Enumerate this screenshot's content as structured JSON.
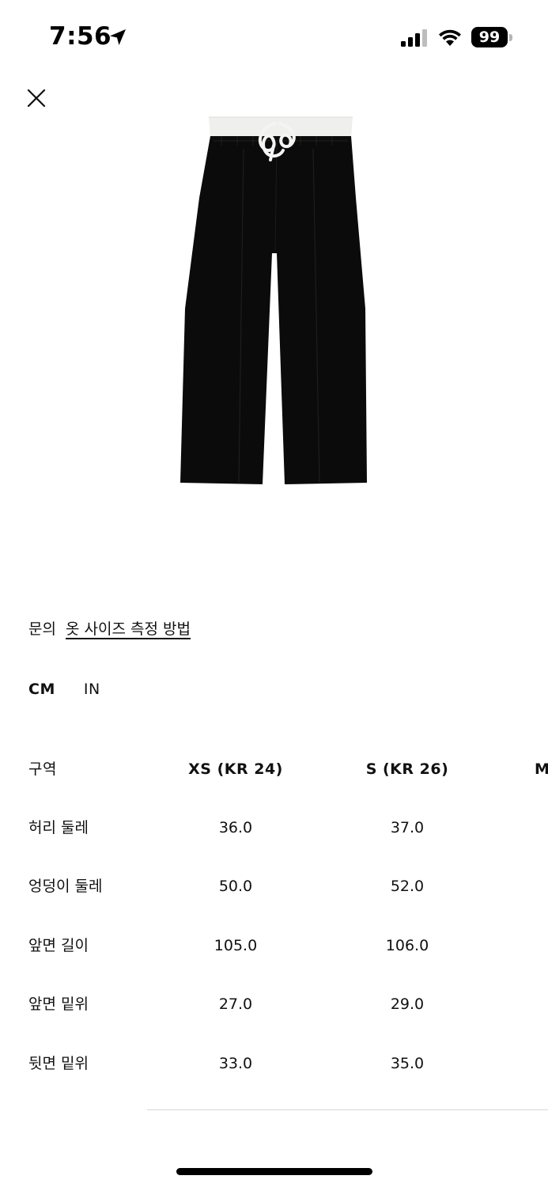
{
  "status_bar": {
    "time": "7:56",
    "battery_level": "99"
  },
  "links": {
    "inquiry": "문의",
    "how_to_measure": "옷 사이즈 측정 방법"
  },
  "units": {
    "cm": "CM",
    "in": "IN",
    "selected": "CM"
  },
  "size_table": {
    "header": {
      "label": "구역",
      "sizes": [
        "XS (KR 24)",
        "S (KR 26)",
        "M"
      ]
    },
    "rows": [
      {
        "label": "허리 둘레",
        "values": [
          "36.0",
          "37.0"
        ]
      },
      {
        "label": "엉덩이 둘레",
        "values": [
          "50.0",
          "52.0"
        ]
      },
      {
        "label": "앞면 길이",
        "values": [
          "105.0",
          "106.0"
        ]
      },
      {
        "label": "앞면 밑위",
        "values": [
          "27.0",
          "29.0"
        ]
      },
      {
        "label": "뒷면 밑위",
        "values": [
          "33.0",
          "35.0"
        ]
      }
    ]
  },
  "colors": {
    "text": "#111111",
    "background": "#ffffff",
    "pants": "#0b0b0b",
    "waistband": "#f0f0ee"
  },
  "icons": {
    "close": "close-icon",
    "location": "location-arrow-icon",
    "signal": "cellular-signal-icon",
    "wifi": "wifi-icon"
  }
}
